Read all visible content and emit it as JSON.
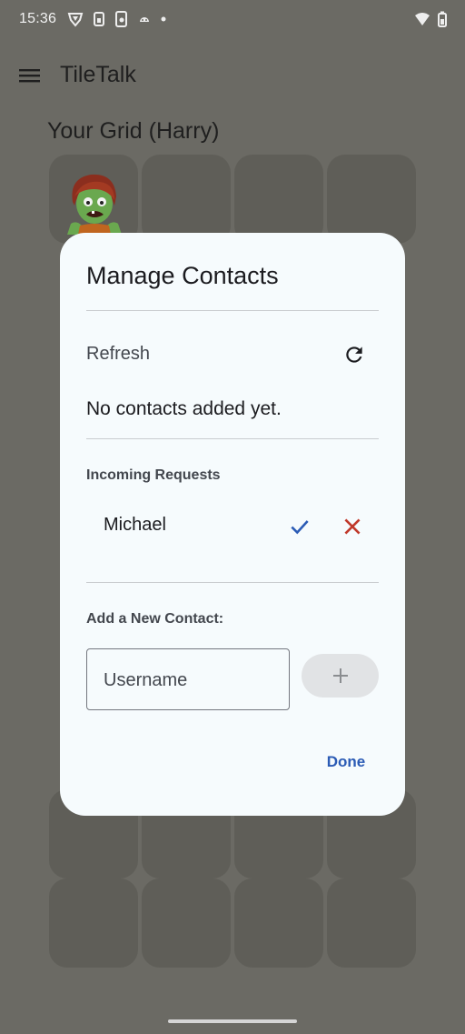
{
  "status_bar": {
    "time": "15:36",
    "icons": [
      "vpn-shield-icon",
      "sim-icon",
      "phone-lock-icon",
      "android-icon",
      "dot-icon"
    ],
    "right_icons": [
      "wifi-icon",
      "battery-icon"
    ]
  },
  "app_bar": {
    "menu_icon": "menu-icon",
    "title": "TileTalk"
  },
  "grid": {
    "title": "Your Grid (Harry)",
    "avatar_icon": "zombie-avatar-icon"
  },
  "dialog": {
    "title": "Manage Contacts",
    "refresh_label": "Refresh",
    "refresh_icon": "refresh-icon",
    "empty_text": "No contacts added yet.",
    "incoming_label": "Incoming Requests",
    "requests": [
      {
        "name": "Michael",
        "accept_icon": "check-icon",
        "reject_icon": "close-icon"
      }
    ],
    "add_label": "Add a New Contact:",
    "username_placeholder": "Username",
    "add_icon": "plus-icon",
    "done_label": "Done"
  },
  "colors": {
    "scrim": "#6b6a64",
    "dialog_bg": "#f6fbfd",
    "accent": "#2b5bb5",
    "reject": "#c0392b"
  }
}
